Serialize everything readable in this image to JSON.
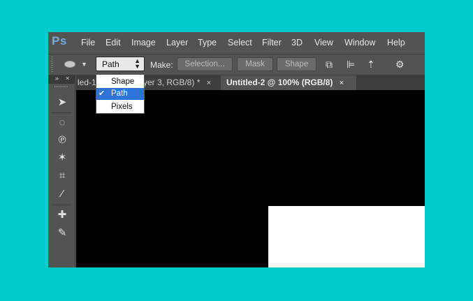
{
  "app": {
    "logo": "Ps"
  },
  "menu": [
    "File",
    "Edit",
    "Image",
    "Layer",
    "Type",
    "Select",
    "Filter",
    "3D",
    "View",
    "Window",
    "Help"
  ],
  "options_bar": {
    "mode_value": "Path",
    "make_label": "Make:",
    "selection_button": "Selection...",
    "mask_button": "Mask",
    "shape_button": "Shape"
  },
  "tabs": [
    {
      "label": "led-1",
      "active": false
    },
    {
      "label": "yer 3, RGB/8) *",
      "active": false,
      "close": "×"
    },
    {
      "label": "Untitled-2 @ 100% (RGB/8)",
      "active": true,
      "close": "×"
    }
  ],
  "panel_header": {
    "collapse": "»",
    "close": "×"
  },
  "dropdown": {
    "items": [
      "Shape",
      "Path",
      "Pixels"
    ],
    "selected": "Path",
    "check": "✔"
  },
  "icons": [
    "ellipse-tool-icon",
    "chevron-down-icon",
    "path-operations-icon",
    "path-alignment-icon",
    "path-arrangement-icon",
    "gear-icon",
    "move-tool-icon",
    "lasso-tool-icon",
    "quick-selection-tool-icon",
    "magic-wand-icon",
    "crop-tool-icon",
    "eyedropper-icon",
    "healing-brush-icon",
    "brush-tool-icon"
  ]
}
